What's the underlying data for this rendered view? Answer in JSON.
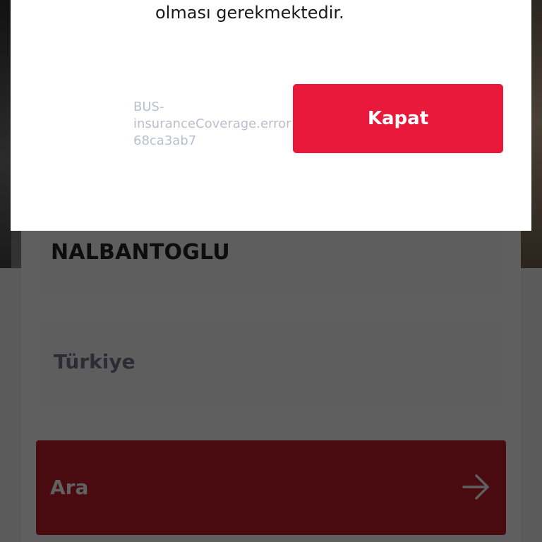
{
  "modal": {
    "message": "olması gerekmektedir.",
    "error_code_lines": [
      "BUS-",
      "insuranceCoverage.error",
      "68ca3ab7"
    ],
    "close_label": "Kapat"
  },
  "form": {
    "surname_value": "NALBANTOGLU",
    "country_value": "Türkiye",
    "search_label": "Ara"
  },
  "icons": {
    "search_arrow": "arrow-right-icon"
  },
  "colors": {
    "accent_red": "#e8193a",
    "dimmed_button": "#490a10",
    "error_text": "#b9c0cc"
  }
}
